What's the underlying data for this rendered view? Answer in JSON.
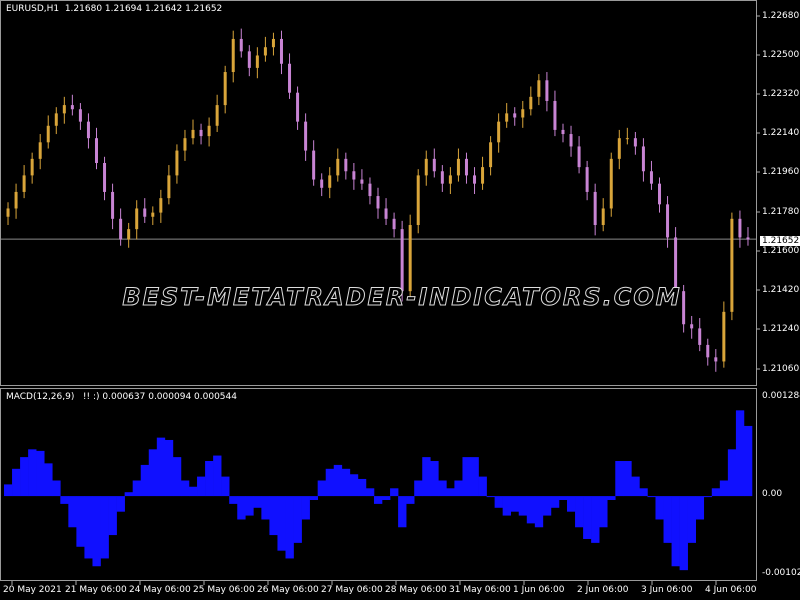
{
  "main_header": "EURUSD,H1  1.21680 1.21694 1.21642 1.21652",
  "macd_header": "MACD(12,26,9)   !! :) 0.000637 0.000094 0.000544",
  "price_axis": [
    "1.22680",
    "1.22500",
    "1.22320",
    "1.22140",
    "1.21960",
    "1.21780",
    "1.21600",
    "1.21420",
    "1.21240",
    "1.21060"
  ],
  "current_price_label": "1.21652",
  "macd_axis": [
    "0.001284",
    "0.00",
    "-0.001025"
  ],
  "time_axis": [
    "20 May 2021",
    "21 May 06:00",
    "24 May 06:00",
    "25 May 06:00",
    "26 May 06:00",
    "27 May 06:00",
    "28 May 06:00",
    "31 May 06:00",
    "1 Jun 06:00",
    "2 Jun 06:00",
    "3 Jun 06:00",
    "4 Jun 06:00"
  ],
  "watermark": "BEST-METATRADER-INDICATORS.COM",
  "colors": {
    "bull": "#d9a53a",
    "bear": "#c884d4",
    "macd": "#1010ff",
    "grid_line": "#8a8a8a",
    "bull_low": "#2e8b2e"
  },
  "chart_data": {
    "type": "candlestick",
    "symbol": "EURUSD",
    "timeframe": "H1",
    "ylim": [
      1.2098,
      1.2276
    ],
    "current_price": 1.21652,
    "close": [
      1.218,
      1.2188,
      1.2196,
      1.2204,
      1.2212,
      1.222,
      1.2226,
      1.223,
      1.2228,
      1.2222,
      1.2214,
      1.2202,
      1.2188,
      1.2175,
      1.2165,
      1.217,
      1.218,
      1.2176,
      1.2178,
      1.2185,
      1.2196,
      1.2208,
      1.2214,
      1.2218,
      1.2215,
      1.222,
      1.223,
      1.2246,
      1.2262,
      1.2256,
      1.2248,
      1.2254,
      1.2258,
      1.2262,
      1.225,
      1.2236,
      1.2222,
      1.2208,
      1.2194,
      1.219,
      1.2196,
      1.2204,
      1.2198,
      1.2194,
      1.2192,
      1.2186,
      1.218,
      1.2175,
      1.217,
      1.214,
      1.2172,
      1.2196,
      1.2204,
      1.2198,
      1.2192,
      1.2196,
      1.2204,
      1.2196,
      1.2192,
      1.22,
      1.2212,
      1.2222,
      1.2226,
      1.2224,
      1.2228,
      1.2234,
      1.2242,
      1.2232,
      1.2218,
      1.2216,
      1.221,
      1.22,
      1.2188,
      1.2172,
      1.218,
      1.2204,
      1.2214,
      1.2214,
      1.221,
      1.2198,
      1.2192,
      1.2182,
      1.2166,
      1.214,
      1.2124,
      1.2122,
      1.2114,
      1.2108,
      1.2106,
      1.213,
      1.2175,
      1.2166,
      1.2165
    ],
    "macd_values": [
      0.00015,
      0.00035,
      0.0005,
      0.0006,
      0.00058,
      0.00042,
      0.0002,
      -0.0001,
      -0.0004,
      -0.00065,
      -0.0008,
      -0.0009,
      -0.0008,
      -0.0005,
      -0.0002,
      5e-05,
      0.0002,
      0.0004,
      0.0006,
      0.00075,
      0.00072,
      0.0005,
      0.0002,
      0.00012,
      0.00025,
      0.00045,
      0.00052,
      0.00025,
      -0.0001,
      -0.0003,
      -0.00025,
      -0.00015,
      -0.0003,
      -0.0005,
      -0.0007,
      -0.0008,
      -0.0006,
      -0.0003,
      -5e-05,
      0.0002,
      0.00035,
      0.0004,
      0.00035,
      0.00028,
      0.00022,
      0.0001,
      -0.0001,
      -5e-05,
      0.0001,
      -0.0004,
      -0.0001,
      0.0002,
      0.0005,
      0.00045,
      0.0002,
      0.0001,
      0.0002,
      0.0005,
      0.0005,
      0.00025,
      0.0,
      -0.00015,
      -0.00025,
      -0.0002,
      -0.00025,
      -0.00035,
      -0.0004,
      -0.00025,
      -0.00015,
      -5e-05,
      -0.0002,
      -0.0004,
      -0.00055,
      -0.0006,
      -0.0004,
      -5e-05,
      0.00045,
      0.00045,
      0.00025,
      0.0001,
      0.0,
      -0.0003,
      -0.0006,
      -0.0009,
      -0.00095,
      -0.0006,
      -0.0003,
      0.0,
      0.0001,
      0.0002,
      0.0006,
      0.0011,
      0.0009
    ],
    "macd_ylim": [
      -0.001025,
      0.001284
    ]
  }
}
